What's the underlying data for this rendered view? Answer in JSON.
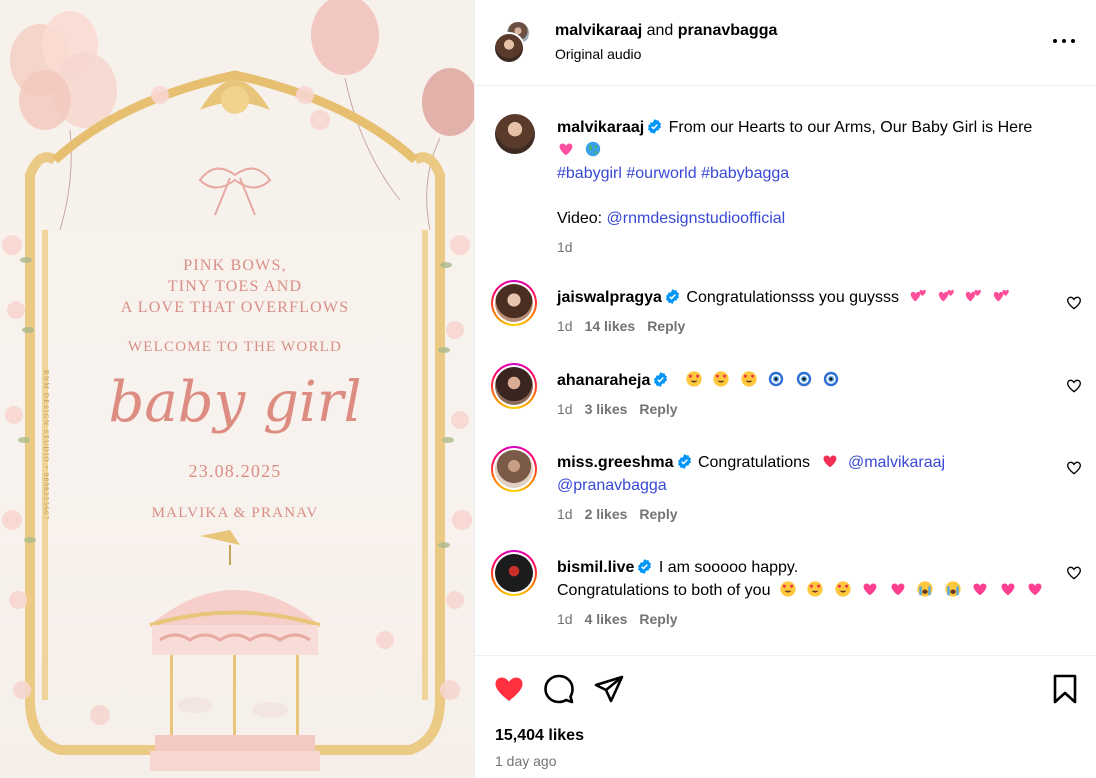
{
  "media": {
    "line1": "PINK BOWS,",
    "line2": "TINY TOES AND",
    "line3": "A LOVE THAT OVERFLOWS",
    "line4": "WELCOME TO THE WORLD",
    "headline": "baby girl",
    "date": "23.08.2025",
    "names": "MALVIKA & PRANAV",
    "studio": "RNM DESIGN STUDIO • 9898355667"
  },
  "header": {
    "author1": "malvikaraaj",
    "joiner": " and ",
    "author2": "pranavbagga",
    "audio": "Original audio"
  },
  "caption": {
    "username": "malvikaraaj",
    "text": "From our Hearts to our Arms, Our Baby Girl is Here",
    "emojis": [
      "pink-heart-emoji",
      "globe-emoji"
    ],
    "hashtags": "#babygirl #ourworld #babybagga",
    "video_label": "Video: ",
    "video_handle": "@rnmdesignstudioofficial",
    "time": "1d"
  },
  "comments": [
    {
      "username": "jaiswalpragya",
      "text": "Congratulationsss you guysss",
      "emojis": [
        "two-hearts-emoji",
        "two-hearts-emoji",
        "two-hearts-emoji",
        "two-hearts-emoji"
      ],
      "time": "1d",
      "likes": "14 likes",
      "reply": "Reply"
    },
    {
      "username": "ahanaraheja",
      "text": "",
      "emojis": [
        "heart-eyes-emoji",
        "heart-eyes-emoji",
        "heart-eyes-emoji",
        "nazar-emoji",
        "nazar-emoji",
        "nazar-emoji"
      ],
      "time": "1d",
      "likes": "3 likes",
      "reply": "Reply"
    },
    {
      "username": "miss.greeshma",
      "text": "Congratulations",
      "emojis": [
        "red-heart-emoji"
      ],
      "mention1": "@malvikaraaj",
      "mention2": "@pranavbagga",
      "time": "1d",
      "likes": "2 likes",
      "reply": "Reply"
    },
    {
      "username": "bismil.live",
      "text": "I am sooooo happy.",
      "text2": "Congratulations to both of you",
      "emojis": [
        "heart-eyes-emoji",
        "heart-eyes-emoji",
        "heart-eyes-emoji",
        "pink-heart-emoji",
        "pink-heart-emoji",
        "crying-emoji",
        "crying-emoji",
        "pink-heart-emoji",
        "pink-heart-emoji",
        "pink-heart-emoji"
      ],
      "time": "1d",
      "likes": "4 likes",
      "reply": "Reply"
    }
  ],
  "footer": {
    "likes": "15,404 likes",
    "ago": "1 day ago"
  },
  "colors": {
    "link": "#3949d6",
    "like_red": "#ff3040",
    "verified_blue": "#0095f6",
    "invite_pink": "#dd8c82",
    "frame_gold": "#e9c57a"
  }
}
